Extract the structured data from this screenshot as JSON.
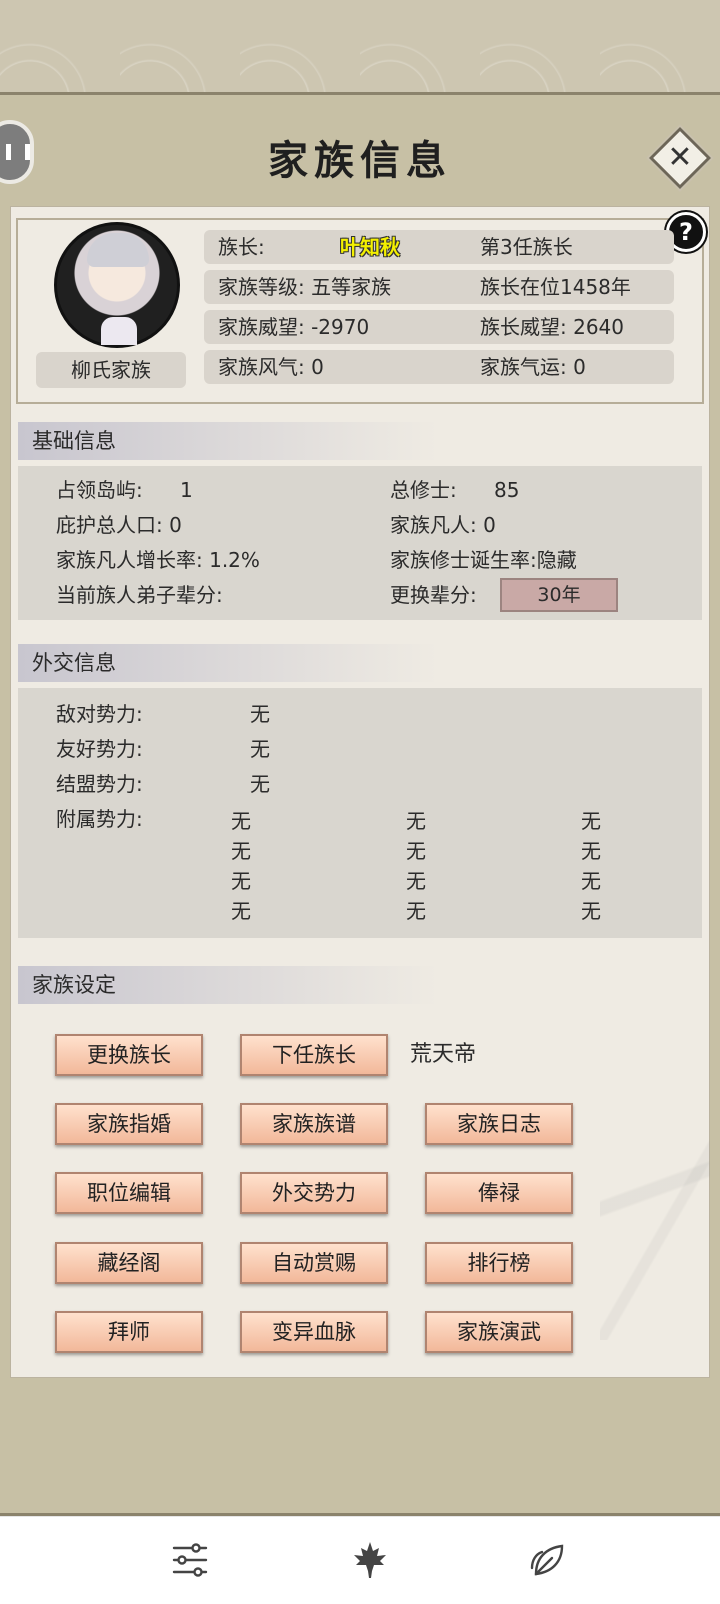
{
  "header": {
    "title": "家族信息",
    "close_glyph": "✕",
    "help_glyph": "?"
  },
  "profile": {
    "family_name": "柳氏家族",
    "rows": [
      {
        "c1": "族长:",
        "name": "叶知秋",
        "c2": "第3任族长"
      },
      {
        "c1": "家族等级: 五等家族",
        "c2": "族长在位1458年"
      },
      {
        "c1": "家族威望: -2970",
        "c2": "族长威望: 2640"
      },
      {
        "c1": "家族风气: 0",
        "c2": "家族气运: 0"
      }
    ]
  },
  "basic": {
    "heading": "基础信息",
    "islands_label": "占领岛屿:",
    "islands_value": "1",
    "cultivators_label": "总修士:",
    "cultivators_value": "85",
    "population": "庇护总人口: 0",
    "mortals": "家族凡人: 0",
    "growth": "家族凡人增长率: 1.2%",
    "birth_rate": "家族修士诞生率:隐藏",
    "generation": "当前族人弟子辈分:",
    "swap_label": "更换辈分:",
    "swap_button": "30年"
  },
  "diplomacy": {
    "heading": "外交信息",
    "hostile_label": "敌对势力:",
    "hostile_value": "无",
    "friendly_label": "友好势力:",
    "friendly_value": "无",
    "alliance_label": "结盟势力:",
    "alliance_value": "无",
    "vassal_label": "附属势力:",
    "vassals": [
      "无",
      "无",
      "无",
      "无",
      "无",
      "无",
      "无",
      "无",
      "无",
      "无",
      "无",
      "无"
    ]
  },
  "settings": {
    "heading": "家族设定",
    "next_leader_name": "荒天帝",
    "buttons": {
      "change_leader": "更换族长",
      "next_leader": "下任族长",
      "marriage": "家族指婚",
      "genealogy": "家族族谱",
      "log": "家族日志",
      "positions": "职位编辑",
      "diplomacy": "外交势力",
      "salary": "俸禄",
      "library": "藏经阁",
      "auto_reward": "自动赏赐",
      "ranking": "排行榜",
      "mentor": "拜师",
      "bloodline": "变异血脉",
      "martial": "家族演武"
    }
  },
  "bottom_nav": [
    "sliders-icon",
    "maple-leaf-icon",
    "leaf-icon"
  ]
}
